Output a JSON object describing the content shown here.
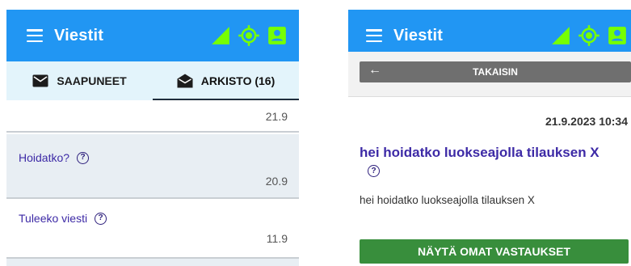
{
  "left": {
    "appbar": {
      "title": "Viestit"
    },
    "tabs": [
      {
        "label": "SAAPUNEET",
        "active": false
      },
      {
        "label": "ARKISTO (16)",
        "active": true
      }
    ],
    "top_row": {
      "date": "21.9"
    },
    "messages": [
      {
        "subject": "Hoidatko?",
        "date": "20.9"
      },
      {
        "subject": "Tuleeko viesti",
        "date": "11.9"
      }
    ]
  },
  "right": {
    "appbar": {
      "title": "Viestit"
    },
    "back_label": "TAKAISIN",
    "message": {
      "datetime": "21.9.2023 10:34",
      "title": "hei hoidatko luokseajolla tilauksen X",
      "body": "hei hoidatko luokseajolla tilauksen X"
    },
    "show_responses_label": "NÄYTÄ OMAT VASTAUKSET"
  },
  "icons": {
    "menu": "menu-icon",
    "signal": "signal-icon",
    "location": "location-icon",
    "profile": "profile-icon",
    "inbox": "mail-icon",
    "archive": "drafts-icon",
    "help": "help-icon",
    "back": "arrow-left-icon"
  },
  "colors": {
    "appbar": "#2196f3",
    "status_icons": "#76ff03",
    "tabs_bg": "#e3f4fb",
    "subject": "#3d2aa6",
    "back_button": "#6f6f6f",
    "action_button": "#388e3c"
  }
}
